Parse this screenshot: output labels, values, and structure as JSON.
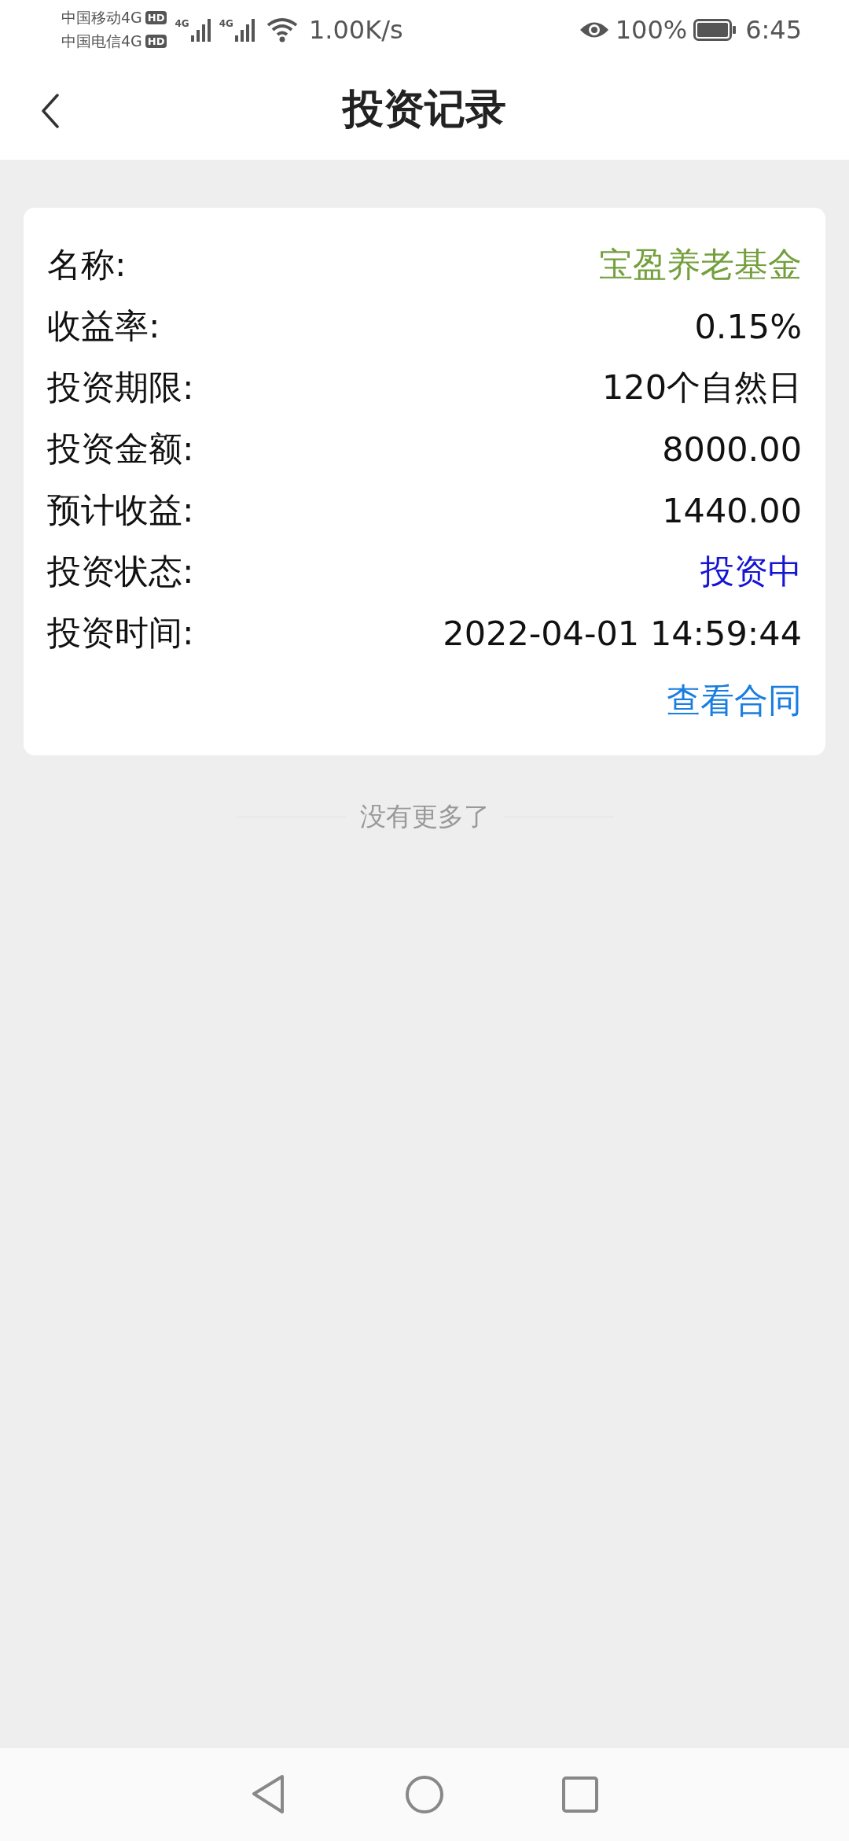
{
  "status_bar": {
    "carriers": [
      "中国移动4G",
      "中国电信4G"
    ],
    "hd_badges": [
      "HD",
      "HD"
    ],
    "network_labels": [
      "4G",
      "4G"
    ],
    "speed": "1.00K/s",
    "battery": "100%",
    "time": "6:45"
  },
  "header": {
    "title": "投资记录"
  },
  "record": {
    "rows": [
      {
        "label": "名称:",
        "value": "宝盈养老基金",
        "color": "#73a03c"
      },
      {
        "label": "收益率:",
        "value": "0.15%",
        "color": "#111111"
      },
      {
        "label": "投资期限:",
        "value": "120个自然日",
        "color": "#111111"
      },
      {
        "label": "投资金额:",
        "value": "8000.00",
        "color": "#111111"
      },
      {
        "label": "预计收益:",
        "value": "1440.00",
        "color": "#111111"
      },
      {
        "label": "投资状态:",
        "value": "投资中",
        "color": "#1414d2"
      },
      {
        "label": "投资时间:",
        "value": "2022-04-01 14:59:44",
        "color": "#111111"
      }
    ],
    "link": "查看合同"
  },
  "footer": {
    "text": "没有更多了"
  }
}
